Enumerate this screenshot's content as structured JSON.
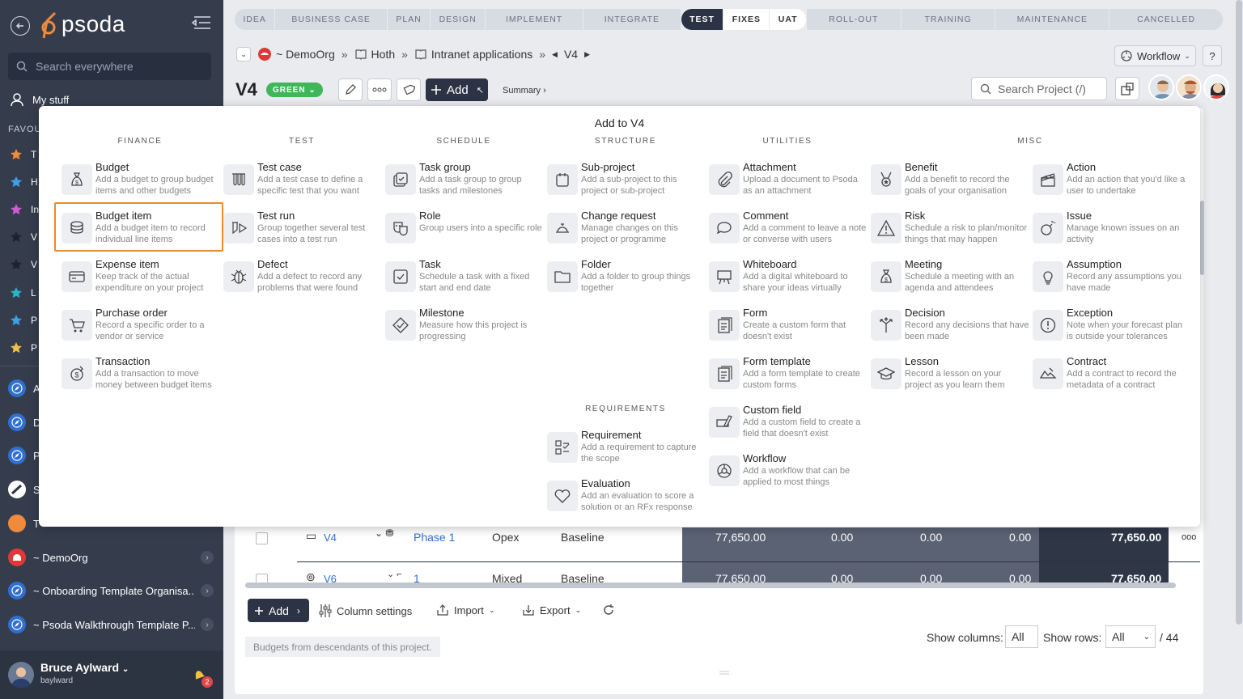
{
  "sidebar": {
    "logo_text": "psoda",
    "search_placeholder": "Search everywhere",
    "my_stuff": "My stuff",
    "favourites_label": "FAVOU",
    "favourites": [
      {
        "letter": "T",
        "color": "#f08a3c"
      },
      {
        "letter": "H",
        "color": "#3ea0e8"
      },
      {
        "letter": "In",
        "color": "#d05cd0"
      },
      {
        "letter": "V",
        "color": "#2b3344"
      },
      {
        "letter": "V",
        "color": "#2b3344"
      },
      {
        "letter": "L",
        "color": "#27b5c9"
      },
      {
        "letter": "P",
        "color": "#3ea0e8"
      },
      {
        "letter": "P",
        "color": "#f2c045"
      }
    ],
    "workspaces": [
      {
        "label": "A",
        "icon": "compass-icon"
      },
      {
        "label": "D",
        "icon": "compass-icon"
      },
      {
        "label": "P",
        "icon": "compass-icon"
      },
      {
        "label": "S",
        "icon": "globe-icon"
      },
      {
        "label": "T",
        "icon": "orange-circle-icon"
      },
      {
        "label": "~ DemoOrg",
        "icon": "org-icon"
      },
      {
        "label": "~ Onboarding Template Organisa...",
        "icon": "compass-icon"
      },
      {
        "label": "~ Psoda Walkthrough Template P...",
        "icon": "compass-icon"
      }
    ],
    "user_name": "Bruce Aylward",
    "user_handle": "baylward",
    "notification_count": "2"
  },
  "phases": [
    "IDEA",
    "BUSINESS CASE",
    "PLAN",
    "DESIGN",
    "IMPLEMENT",
    "INTEGRATE",
    "TEST",
    "FIXES",
    "UAT",
    "ROLL-OUT",
    "TRAINING",
    "MAINTENANCE",
    "CANCELLED"
  ],
  "breadcrumb": {
    "items": [
      "~ DemoOrg",
      "Hoth",
      "Intranet applications",
      "V4"
    ]
  },
  "header": {
    "title": "V4",
    "rag": "GREEN",
    "add_label": "Add",
    "summary": "Summary ›",
    "workflow": "Workflow",
    "help": "?",
    "search_placeholder": "Search Project (/)"
  },
  "modal": {
    "title": "Add to V4",
    "categories": {
      "finance": "FINANCE",
      "test": "TEST",
      "schedule": "SCHEDULE",
      "structure": "STRUCTURE",
      "utilities": "UTILITIES",
      "misc": "MISC",
      "requirements": "REQUIREMENTS"
    },
    "items": {
      "budget": {
        "title": "Budget",
        "desc": "Add a budget to group budget items and other budgets"
      },
      "budget_item": {
        "title": "Budget item",
        "desc": "Add a budget item to record individual line items"
      },
      "expense_item": {
        "title": "Expense item",
        "desc": "Keep track of the actual expenditure on your project"
      },
      "purchase_order": {
        "title": "Purchase order",
        "desc": "Record a specific order to a vendor or service"
      },
      "transaction": {
        "title": "Transaction",
        "desc": "Add a transaction to move money between budget items"
      },
      "test_case": {
        "title": "Test case",
        "desc": "Add a test case to define a specific test that you want"
      },
      "test_run": {
        "title": "Test run",
        "desc": "Group together several test cases into a test run"
      },
      "defect": {
        "title": "Defect",
        "desc": "Add a defect to record any problems that were found"
      },
      "task_group": {
        "title": "Task group",
        "desc": "Add a task group to group tasks and milestones"
      },
      "role": {
        "title": "Role",
        "desc": "Group users into a specific role"
      },
      "task": {
        "title": "Task",
        "desc": "Schedule a task with a fixed start and end date"
      },
      "milestone": {
        "title": "Milestone",
        "desc": "Measure how this project is progressing"
      },
      "sub_project": {
        "title": "Sub-project",
        "desc": "Add a sub-project to this project or sub-project"
      },
      "change_request": {
        "title": "Change request",
        "desc": "Manage changes on this project or programme"
      },
      "folder": {
        "title": "Folder",
        "desc": "Add a folder to group things together"
      },
      "requirement": {
        "title": "Requirement",
        "desc": "Add a requirement to capture the scope"
      },
      "evaluation": {
        "title": "Evaluation",
        "desc": "Add an evaluation to score a solution or an RFx response"
      },
      "attachment": {
        "title": "Attachment",
        "desc": "Upload a document to Psoda as an attachment"
      },
      "comment": {
        "title": "Comment",
        "desc": "Add a comment to leave a note or converse with users"
      },
      "whiteboard": {
        "title": "Whiteboard",
        "desc": "Add a digital whiteboard to share your ideas virtually"
      },
      "form": {
        "title": "Form",
        "desc": "Create a custom form that doesn't exist"
      },
      "form_template": {
        "title": "Form template",
        "desc": "Add a form template to create custom forms"
      },
      "custom_field": {
        "title": "Custom field",
        "desc": "Add a custom field to create a field that doesn't exist"
      },
      "workflow": {
        "title": "Workflow",
        "desc": "Add a workflow that can be applied to most things"
      },
      "benefit": {
        "title": "Benefit",
        "desc": "Add a benefit to record the goals of your organisation"
      },
      "risk": {
        "title": "Risk",
        "desc": "Schedule a risk to plan/monitor things that may happen"
      },
      "meeting": {
        "title": "Meeting",
        "desc": "Schedule a meeting with an agenda and attendees"
      },
      "decision": {
        "title": "Decision",
        "desc": "Record any decisions that have been made"
      },
      "lesson": {
        "title": "Lesson",
        "desc": "Record a lesson on your project as you learn them"
      },
      "action": {
        "title": "Action",
        "desc": "Add an action that you'd like a user to undertake"
      },
      "issue": {
        "title": "Issue",
        "desc": "Manage known issues on an activity"
      },
      "assumption": {
        "title": "Assumption",
        "desc": "Record any assumptions you have made"
      },
      "exception": {
        "title": "Exception",
        "desc": "Note when your forecast plan is outside your tolerances"
      },
      "contract": {
        "title": "Contract",
        "desc": "Add a contract to record the metadata of a contract"
      }
    }
  },
  "table": {
    "rows": [
      {
        "name": "V4",
        "phase": "Phase 1",
        "type": "Opex",
        "baseline": "Baseline",
        "v1": "77,650.00",
        "v2": "0.00",
        "v3": "0.00",
        "v4": "0.00",
        "total": "77,650.00"
      },
      {
        "name": "V6",
        "phase": "1",
        "type": "Mixed",
        "baseline": "Baseline",
        "v1": "77,650.00",
        "v2": "0.00",
        "v3": "0.00",
        "v4": "0.00",
        "total": "77,650.00"
      }
    ]
  },
  "footer": {
    "add_label": "Add",
    "column_settings": "Column settings",
    "import": "Import",
    "export": "Export",
    "show_columns_label": "Show columns:",
    "show_columns_value": "All",
    "show_rows_label": "Show rows:",
    "show_rows_value": "All",
    "total": "/ 44",
    "footnote": "Budgets from descendants of this project."
  }
}
